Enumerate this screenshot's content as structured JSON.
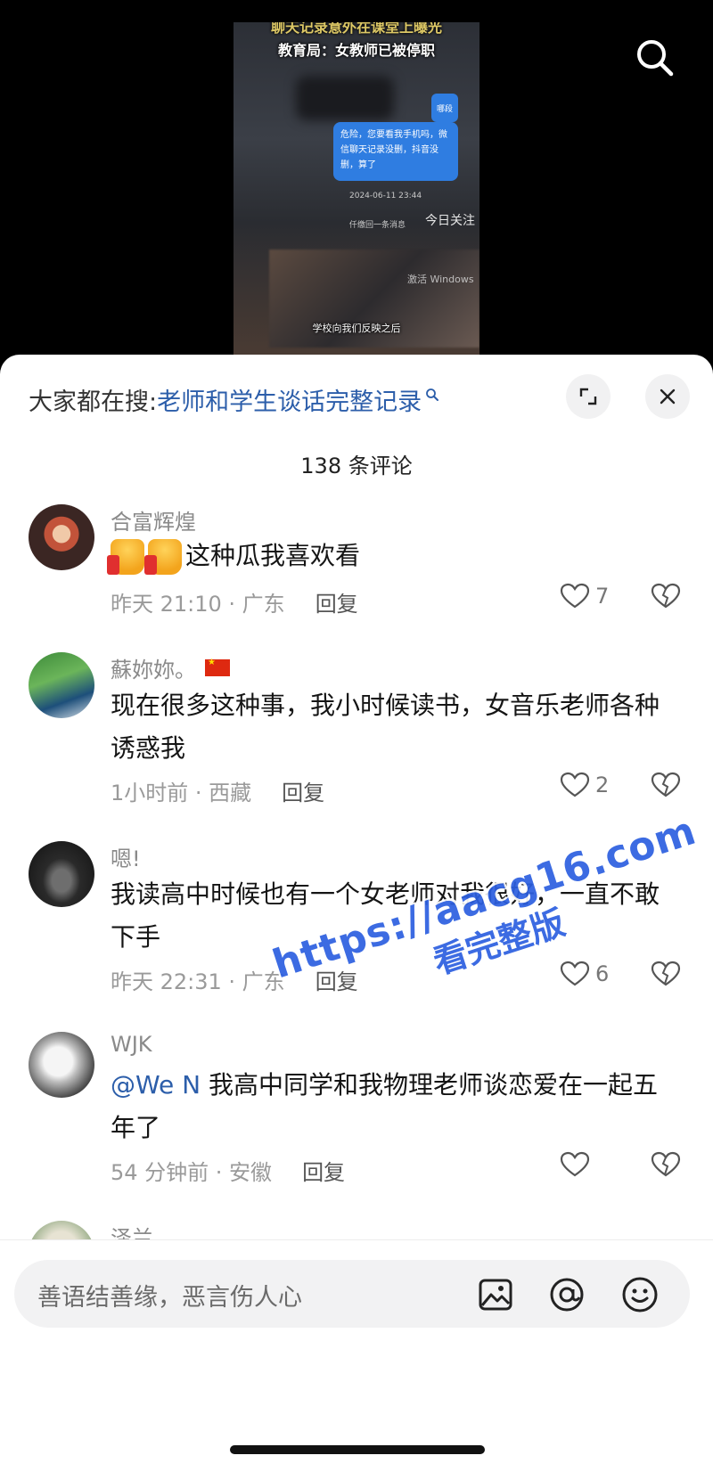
{
  "video": {
    "caption_top": "聊天记录意外在课堂上曝光",
    "caption_main": "教育局：女教师已被停职",
    "bubble_small": "哪段",
    "bubble_text": "危险，您要看我手机吗，微信聊天记录没删，抖音没删，算了",
    "timestamp": "2024-06-11 23:44",
    "line2": "仟缴回一条消息",
    "signature": "今日关注",
    "win_mark": "激活 Windows",
    "subtitle": "学校向我们反映之后",
    "search_icon": "search-icon"
  },
  "panel": {
    "search_prefix": "大家都在搜:",
    "search_term": "老师和学生谈话完整记录",
    "comment_count": "138 条评论",
    "expand_icon": "expand-icon",
    "close_icon": "close-icon"
  },
  "comments": [
    {
      "name": "合富辉煌",
      "text": "这种瓜我喜欢看",
      "time": "昨天 21:10 · 广东",
      "reply": "回复",
      "likes": "7"
    },
    {
      "name": "蘇妳妳。",
      "text": "现在很多这种事，我小时候读书，女音乐老师各种诱惑我",
      "time": "1小时前 · 西藏",
      "reply": "回复",
      "likes": "2"
    },
    {
      "name": "嗯!",
      "text": "我读高中时候也有一个女老师对我很好，一直不敢下手",
      "time": "昨天 22:31 · 广东",
      "reply": "回复",
      "likes": "6"
    },
    {
      "name": "WJK",
      "mention": "@We N",
      "text": " 我高中同学和我物理老师谈恋爱在一起五年了",
      "time": "54 分钟前 · 安徽",
      "reply": "回复",
      "likes": ""
    },
    {
      "name": "泽兰"
    }
  ],
  "input": {
    "placeholder": "善语结善缘，恶言伤人心",
    "icons": [
      "image-icon",
      "at-icon",
      "emoji-icon"
    ]
  },
  "watermark": {
    "line1": "https://aacg16.com",
    "line2": "看完整版"
  },
  "colors": {
    "link": "#2c5eaa",
    "watermark": "#2c5fe0",
    "text_secondary": "#9a9a9a"
  }
}
